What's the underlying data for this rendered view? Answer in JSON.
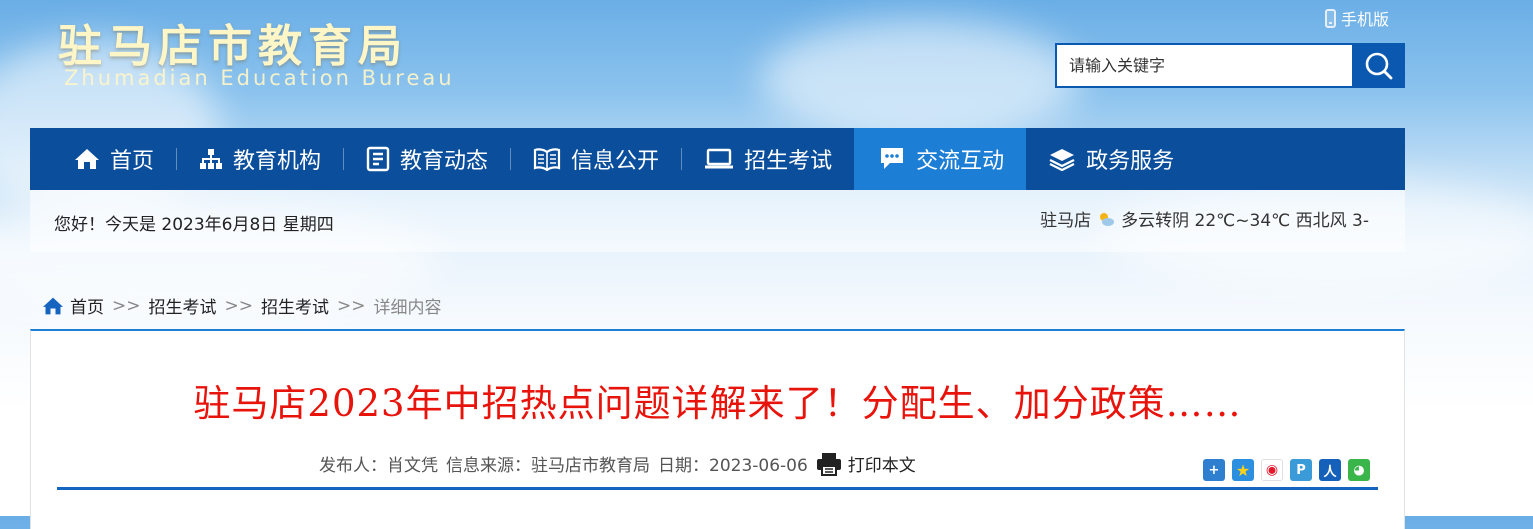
{
  "header": {
    "site_title": "驻马店市教育局",
    "site_subtitle": "Zhumadian Education Bureau",
    "mobile_label": "手机版",
    "search_placeholder": "请输入关键字"
  },
  "nav": {
    "items": [
      {
        "label": "首页",
        "icon": "home-icon"
      },
      {
        "label": "教育机构",
        "icon": "org-chart-icon"
      },
      {
        "label": "教育动态",
        "icon": "document-icon"
      },
      {
        "label": "信息公开",
        "icon": "book-icon"
      },
      {
        "label": "招生考试",
        "icon": "laptop-icon"
      },
      {
        "label": "交流互动",
        "icon": "chat-icon"
      },
      {
        "label": "政务服务",
        "icon": "layers-icon"
      }
    ],
    "active_index": 5
  },
  "info_bar": {
    "greeting": "您好！今天是 2023年6月8日 星期四",
    "weather_city": "驻马店",
    "weather_text": "多云转阴 22℃~34℃ 西北风 3-"
  },
  "breadcrumb": {
    "home": "首页",
    "sep": ">>",
    "level1": "招生考试",
    "level2": "招生考试",
    "current": "详细内容"
  },
  "article": {
    "title": "驻马店2023年中招热点问题详解来了！分配生、加分政策……",
    "publisher_label": "发布人：",
    "publisher": "肖文凭",
    "source_label": "信息来源：",
    "source": "驻马店市教育局",
    "date_label": "日期：",
    "date": "2023-06-06",
    "print_label": "打印本文"
  },
  "share": {
    "buttons": [
      "share-more-icon",
      "qzone-icon",
      "weibo-icon",
      "tencent-weibo-icon",
      "renren-icon",
      "wechat-icon"
    ]
  },
  "colors": {
    "nav_bg": "#0b4f9c",
    "nav_active": "#1d7ed6",
    "title_red": "#e8130b",
    "search_blue": "#0a58b0"
  }
}
